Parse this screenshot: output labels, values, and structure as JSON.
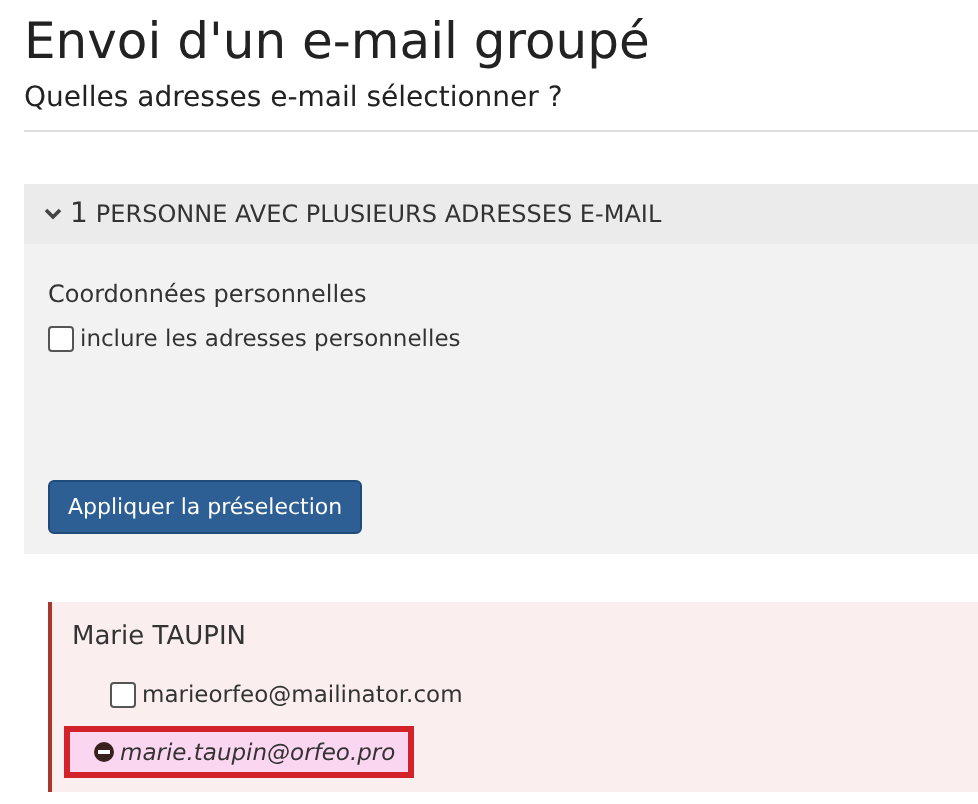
{
  "title": "Envoi d'un e-mail groupé",
  "subtitle": "Quelles adresses e-mail sélectionner ?",
  "section": {
    "count": "1",
    "heading": "PERSONNE AVEC PLUSIEURS ADRESSES E-MAIL",
    "expanded": true,
    "group_label": "Coordonnées personnelles",
    "option": {
      "label": "inclure les adresses personnelles",
      "checked": false
    },
    "apply_button": "Appliquer la préselection"
  },
  "person": {
    "name": "Marie TAUPIN",
    "emails": [
      {
        "kind": "checkbox",
        "address": "marieorfeo@mailinator.com",
        "checked": false,
        "highlighted": false
      },
      {
        "kind": "blocked",
        "address": "marie.taupin@orfeo.pro",
        "highlighted": true
      }
    ]
  }
}
